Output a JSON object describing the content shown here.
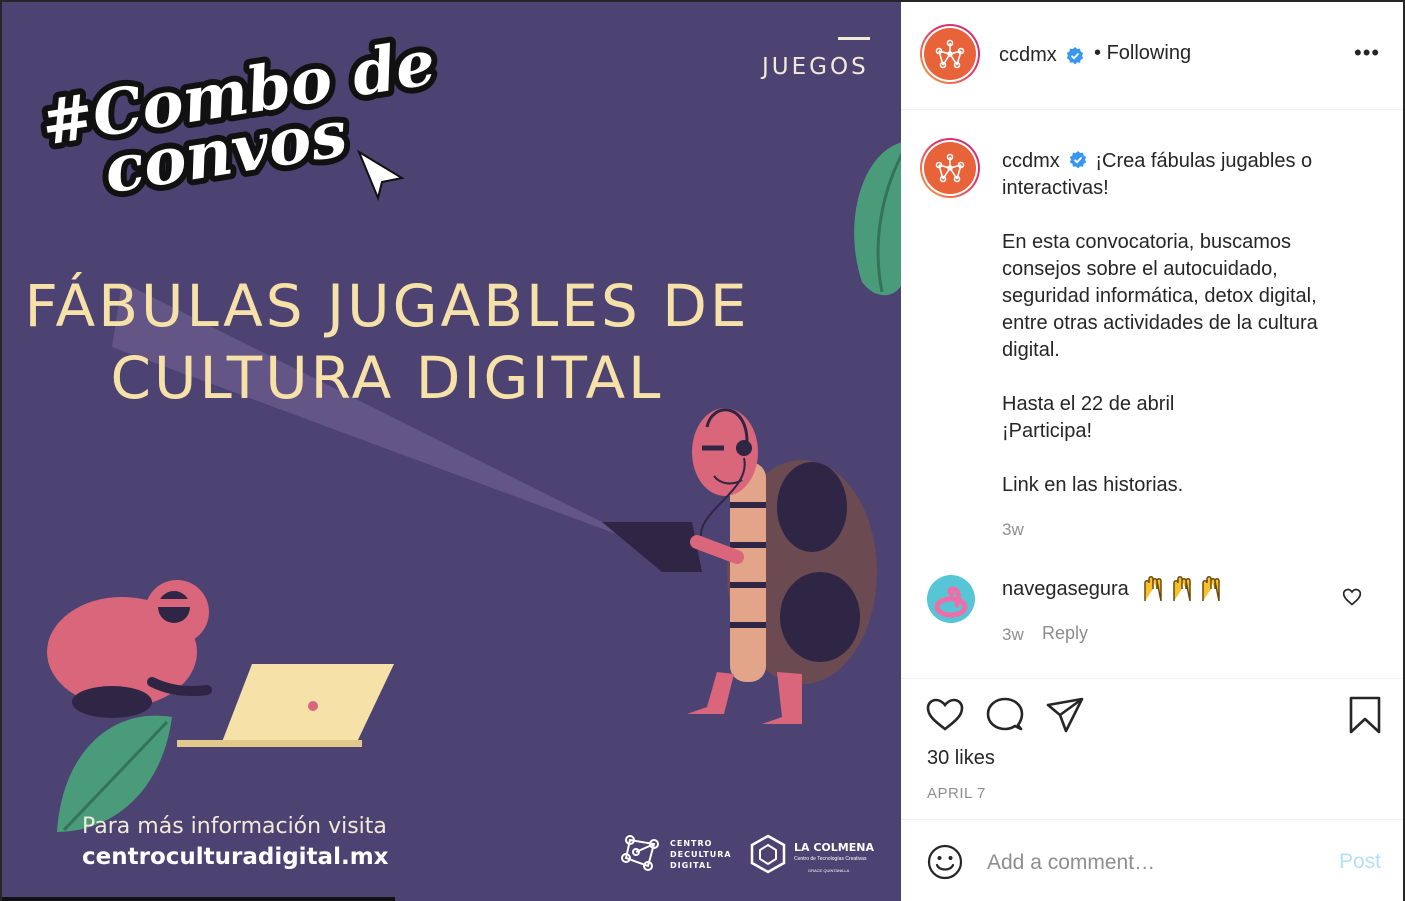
{
  "post_image": {
    "hashtag_line1": "#Combo de",
    "hashtag_line2": "convos",
    "category": "JUEGOS",
    "headline_line1": "FÁBULAS JUGABLES DE",
    "headline_line2": "CULTURA DIGITAL",
    "info_line1": "Para más información visita",
    "info_line2": "centroculturadigital.mx",
    "logo1_line1": "CENTRO",
    "logo1_line2": "DECULTURA",
    "logo1_line3": "DIGITAL",
    "logo2_name": "LA COLMENA",
    "logo2_sub": "Centro de Tecnologías Creativas",
    "logo2_sub2": "GRACE QUINTANILLA",
    "colors": {
      "background": "#4d4372",
      "headline": "#f6e1a9"
    }
  },
  "header": {
    "username": "ccdmx",
    "separator": "•",
    "follow_status": "Following",
    "more_icon": "more-horizontal-icon"
  },
  "caption": {
    "username": "ccdmx",
    "paragraphs": [
      "¡Crea fábulas jugables o interactivas!",
      "En esta convocatoria, buscamos consejos sobre el autocuidado, seguridad informática, detox digital, entre otras actividades de la cultura digital.",
      "Hasta el 22 de abril\n¡Participa!",
      "Link en las historias."
    ],
    "time": "3w"
  },
  "comments": [
    {
      "username": "navegasegura",
      "emoji_count": 3,
      "time": "3w",
      "reply_label": "Reply"
    }
  ],
  "actions": {
    "icons": [
      "heart-icon",
      "comment-icon",
      "share-icon",
      "bookmark-icon"
    ],
    "likes": "30 likes",
    "date": "APRIL 7"
  },
  "comment_box": {
    "placeholder": "Add a comment…",
    "post_label": "Post"
  },
  "colors": {
    "verified": "#3897f0",
    "post_button": "#b2dffc",
    "muted": "#8e8e8e"
  }
}
